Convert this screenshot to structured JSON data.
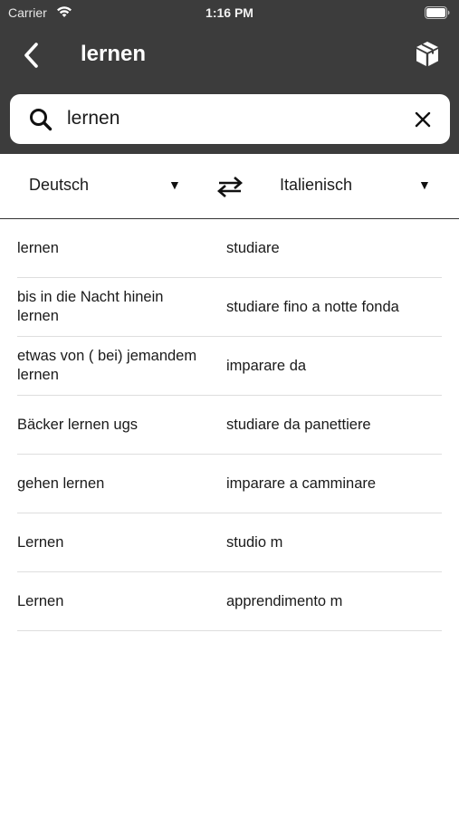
{
  "status_bar": {
    "carrier": "Carrier",
    "time": "1:16 PM"
  },
  "nav": {
    "title": "lernen"
  },
  "search": {
    "query": "lernen"
  },
  "languages": {
    "from": "Deutsch",
    "to": "Italienisch"
  },
  "results": [
    {
      "de": "lernen",
      "it": "studiare"
    },
    {
      "de": "bis in die Nacht hinein lernen",
      "it": "studiare fino a notte fonda"
    },
    {
      "de": "etwas von ( bei) jemandem lernen",
      "it": "imparare  da"
    },
    {
      "de": "Bäcker lernen ugs",
      "it": "studiare da panettiere"
    },
    {
      "de": "gehen lernen",
      "it": "imparare a camminare"
    },
    {
      "de": "Lernen",
      "it": "studio m"
    },
    {
      "de": "Lernen",
      "it": "apprendimento m"
    }
  ]
}
